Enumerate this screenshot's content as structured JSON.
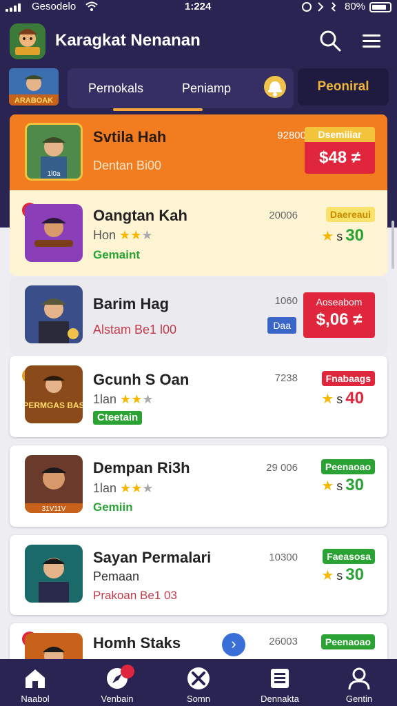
{
  "status": {
    "carrier": "Gesodelo",
    "time": "1:224",
    "battery": "80%"
  },
  "app": {
    "title": "Karagkat Nenanan"
  },
  "tabs": {
    "tab1": "Pernokals",
    "tab2": "Peniamp",
    "special": "Peoniral"
  },
  "thumb_tab_label": "ARABOAK",
  "rows": [
    {
      "name": "Svtila Hah",
      "sub": "Dentan Bi00",
      "number": "92800",
      "badge": "Dsemiiiar",
      "price": "$48 ≠",
      "thumb_label": "1l0a"
    },
    {
      "name": "Oangtan Kah",
      "sub": "Hon",
      "green": "Gemaint",
      "number": "20006",
      "badge": "Daereaui",
      "rating": "30",
      "corner": "1"
    },
    {
      "name": "Barim Hag",
      "sub": "Alstam Be1 l00",
      "number": "1060",
      "price_label": "Aoseabom",
      "price": "$,06 ≠",
      "blue_badge": "Daa"
    },
    {
      "name": "Gcunh S Oan",
      "sub": "1lan",
      "pill": "Cteetain",
      "number": "7238",
      "badge": "Fnabaags",
      "rating": "40",
      "corner": "2",
      "thumb_label": "PERMGAS BAS"
    },
    {
      "name": "Dempan Ri3h",
      "sub": "1lan",
      "green": "Gemiin",
      "number": "29 006",
      "badge": "Peenaoao",
      "rating": "30",
      "thumb_label": "31V11V"
    },
    {
      "name": "Sayan Permalari",
      "sub": "Pemaan",
      "sub2": "Prakoan Be1 03",
      "number": "10300",
      "badge": "Faeasosa",
      "rating": "30"
    },
    {
      "name": "Homh Staks",
      "number": "26003",
      "badge": "Peenaoao",
      "corner": "1"
    }
  ],
  "rating_prefix": "s",
  "nav": [
    "Naabol",
    "Venbain",
    "Somn",
    "Dennakta",
    "Gentin"
  ],
  "colors": {
    "header_bg": "#2a2452",
    "accent_orange": "#f27d21",
    "price_red": "#e0263d",
    "green": "#2aa334",
    "gold": "#ecb43a"
  },
  "icons": [
    "signal-icon",
    "wifi-icon",
    "battery-icon",
    "search-icon",
    "menu-icon",
    "bell-icon",
    "star-icon",
    "chevron-right-icon",
    "home-icon",
    "compass-icon",
    "tools-icon",
    "document-icon",
    "profile-icon"
  ]
}
